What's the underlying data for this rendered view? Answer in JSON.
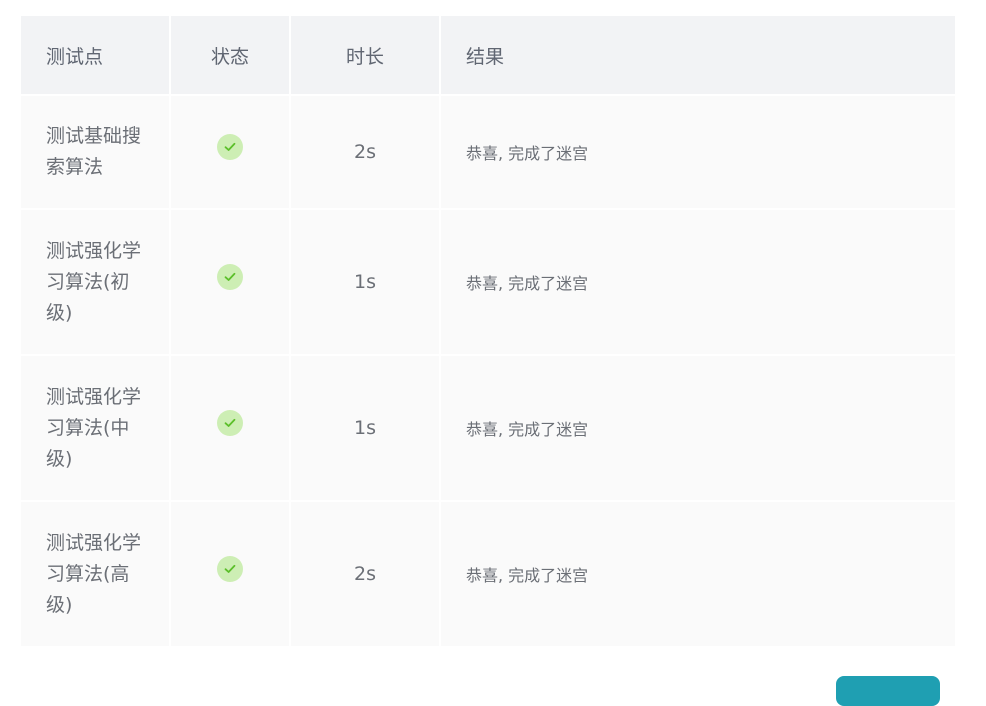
{
  "table": {
    "headers": {
      "point": "测试点",
      "status": "状态",
      "duration": "时长",
      "result": "结果"
    },
    "rows": [
      {
        "point": "测试基础搜索算法",
        "status": "passed",
        "duration": "2s",
        "result": "恭喜, 完成了迷宫"
      },
      {
        "point": "测试强化学习算法(初级)",
        "status": "passed",
        "duration": "1s",
        "result": "恭喜, 完成了迷宫"
      },
      {
        "point": "测试强化学习算法(中级)",
        "status": "passed",
        "duration": "1s",
        "result": "恭喜, 完成了迷宫"
      },
      {
        "point": "测试强化学习算法(高级)",
        "status": "passed",
        "duration": "2s",
        "result": "恭喜, 完成了迷宫"
      }
    ]
  },
  "icons": {
    "status": "check-circle-icon"
  },
  "colors": {
    "success_bg": "#cdeeb4",
    "success_check": "#5cbf2a",
    "header_bg": "#f2f3f5",
    "row_bg": "#fafafa",
    "button": "#1f9fb2"
  }
}
